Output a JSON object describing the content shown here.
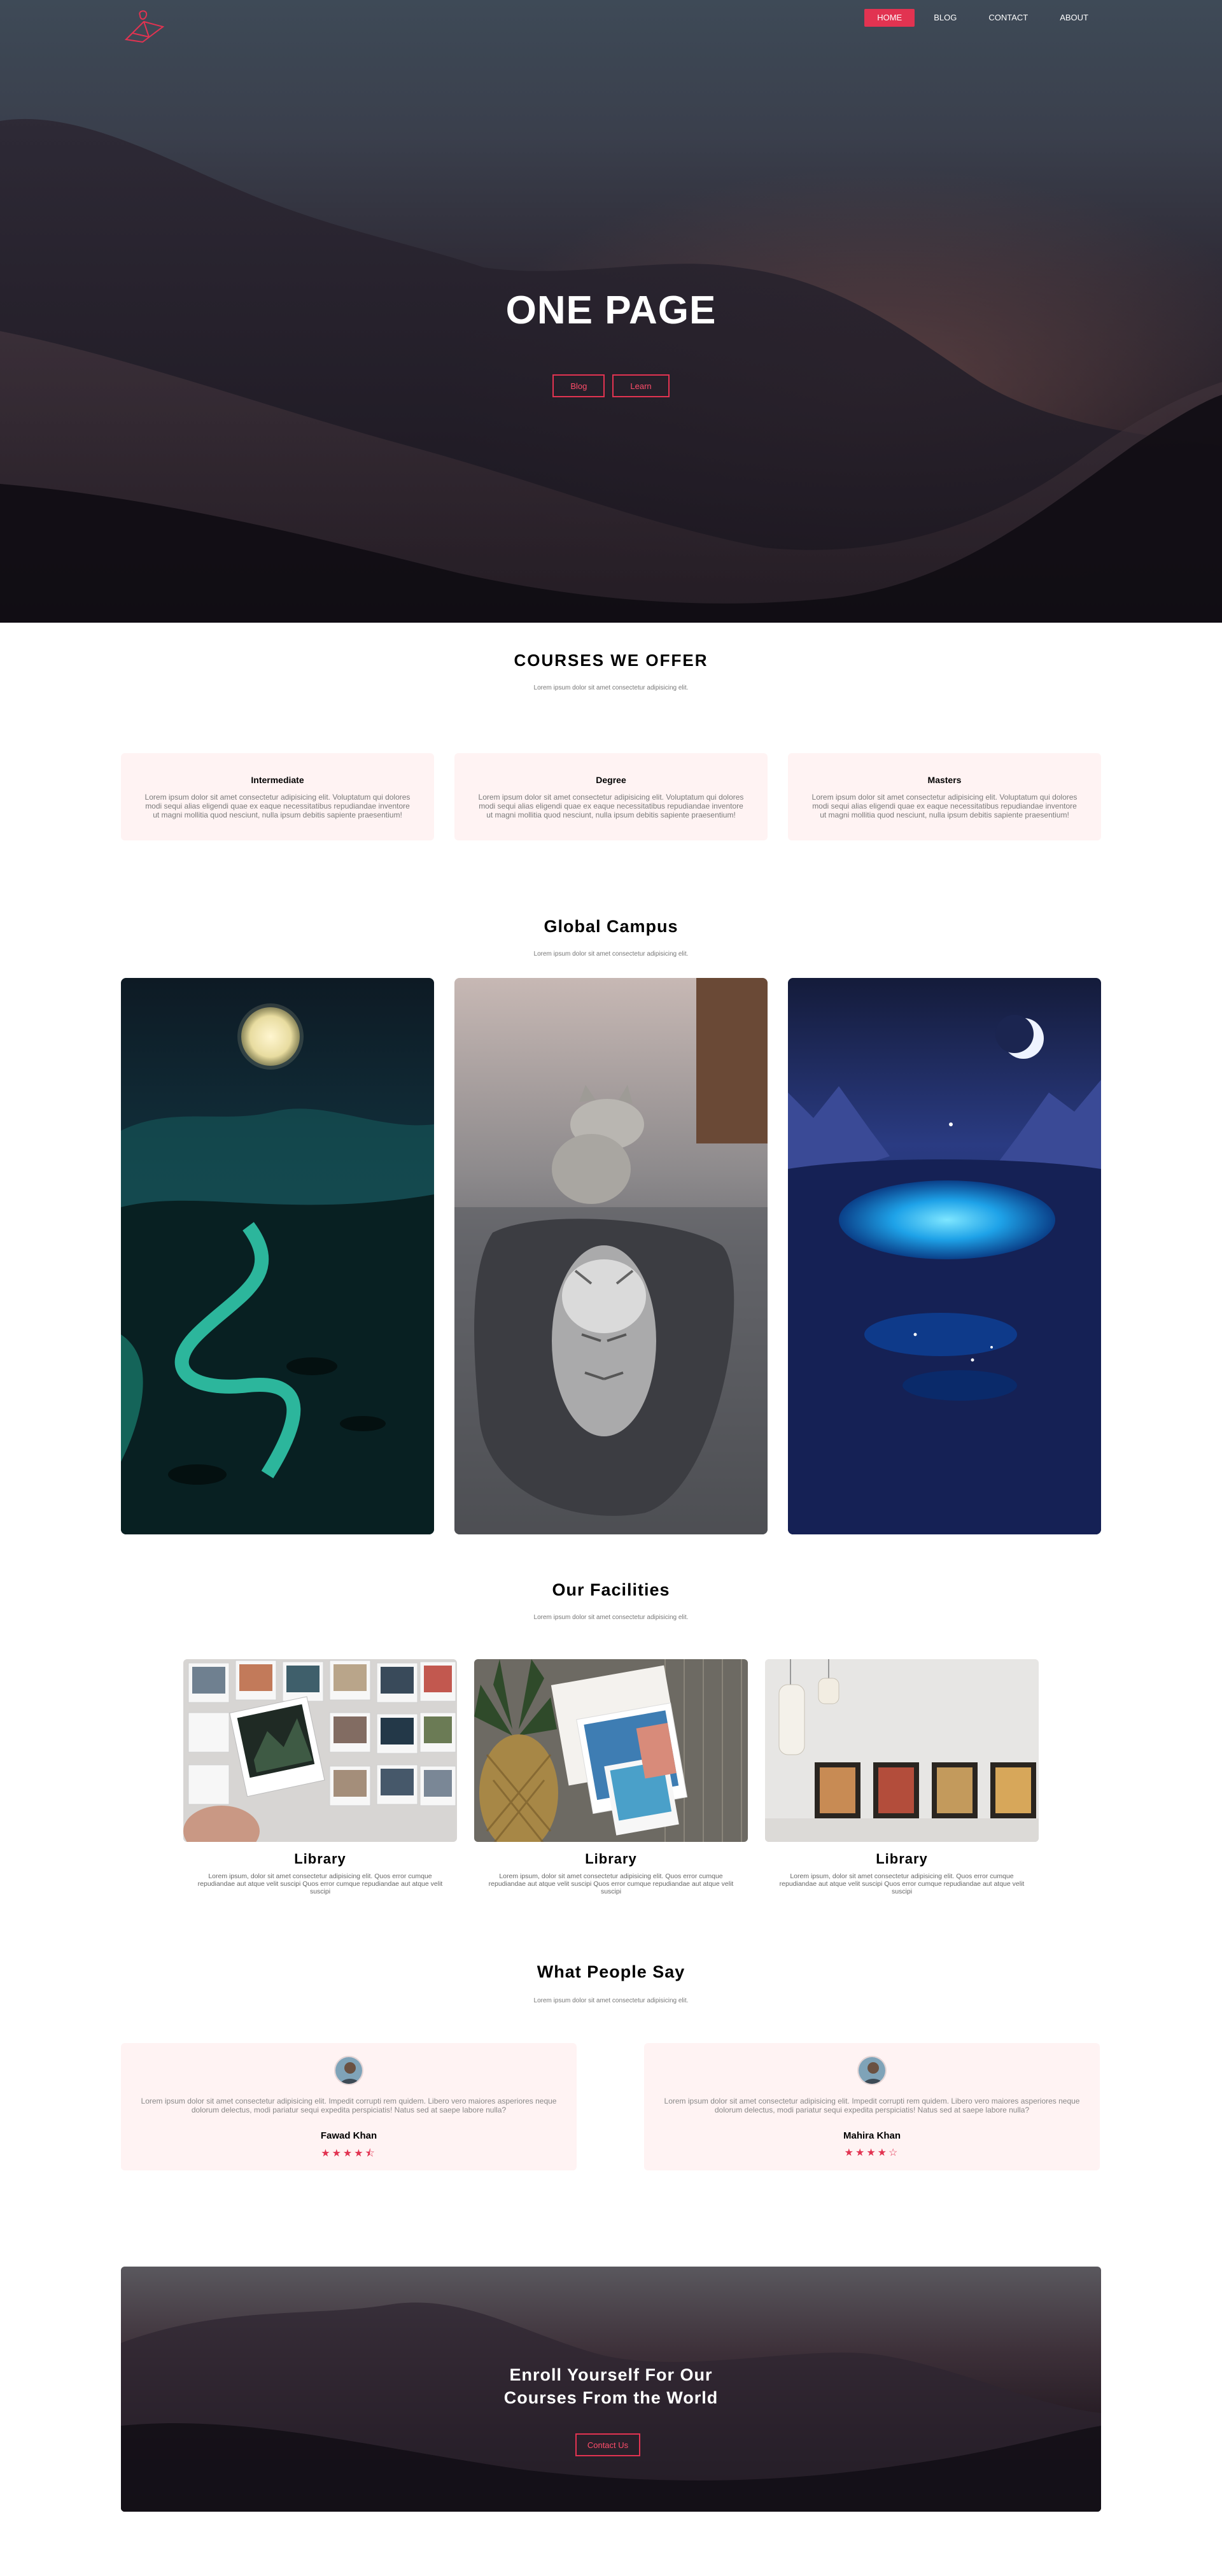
{
  "nav": {
    "logo": "logo-icon",
    "items": [
      {
        "label": "HOME",
        "active": true
      },
      {
        "label": "BLOG",
        "active": false
      },
      {
        "label": "CONTACT",
        "active": false
      },
      {
        "label": "ABOUT",
        "active": false
      }
    ]
  },
  "hero": {
    "title": "ONE PAGE",
    "buttons": [
      "Blog",
      "Learn"
    ]
  },
  "courses": {
    "title": "COURSES WE OFFER",
    "subtitle": "Lorem ipsum dolor sit amet consectetur adipisicing elit.",
    "items": [
      {
        "title": "Intermediate",
        "text": "Lorem ipsum dolor sit amet consectetur adipisicing elit. Voluptatum qui dolores modi sequi alias eligendi quae ex eaque necessitatibus repudiandae inventore ut magni mollitia quod nesciunt, nulla ipsum debitis sapiente praesentium!"
      },
      {
        "title": "Degree",
        "text": "Lorem ipsum dolor sit amet consectetur adipisicing elit. Voluptatum qui dolores modi sequi alias eligendi quae ex eaque necessitatibus repudiandae inventore ut magni mollitia quod nesciunt, nulla ipsum debitis sapiente praesentium!"
      },
      {
        "title": "Masters",
        "text": "Lorem ipsum dolor sit amet consectetur adipisicing elit. Voluptatum qui dolores modi sequi alias eligendi quae ex eaque necessitatibus repudiandae inventore ut magni mollitia quod nesciunt, nulla ipsum debitis sapiente praesentium!"
      }
    ]
  },
  "campus": {
    "title": "Global Campus",
    "subtitle": "Lorem ipsum dolor sit amet consectetur adipisicing elit."
  },
  "facilities": {
    "title": "Our Facilities",
    "subtitle": "Lorem ipsum dolor sit amet consectetur adipisicing elit.",
    "items": [
      {
        "title": "Library",
        "text": "Lorem ipsum, dolor sit amet consectetur adipisicing elit. Quos error cumque repudiandae aut atque velit suscipi Quos error cumque repudiandae aut atque velit suscipi"
      },
      {
        "title": "Library",
        "text": "Lorem ipsum, dolor sit amet consectetur adipisicing elit. Quos error cumque repudiandae aut atque velit suscipi Quos error cumque repudiandae aut atque velit suscipi"
      },
      {
        "title": "Library",
        "text": "Lorem ipsum, dolor sit amet consectetur adipisicing elit. Quos error cumque repudiandae aut atque velit suscipi Quos error cumque repudiandae aut atque velit suscipi"
      }
    ]
  },
  "testimonials": {
    "title": "What People Say",
    "subtitle": "Lorem ipsum dolor sit amet consectetur adipisicing elit.",
    "items": [
      {
        "name": "Fawad Khan",
        "text": "Lorem ipsum dolor sit amet consectetur adipisicing elit. Impedit corrupti rem quidem. Libero vero maiores asperiores neque dolorum delectus, modi pariatur sequi expedita perspiciatis! Natus sed at saepe labore nulla?",
        "stars": "★★★★⯪",
        "rating": 4.5
      },
      {
        "name": "Mahira Khan",
        "text": "Lorem ipsum dolor sit amet consectetur adipisicing elit. Impedit corrupti rem quidem. Libero vero maiores asperiores neque dolorum delectus, modi pariatur sequi expedita perspiciatis! Natus sed at saepe labore nulla?",
        "stars": "★★★★☆",
        "rating": 4
      }
    ]
  },
  "enroll": {
    "title_line1": "Enroll Yourself For Our",
    "title_line2": "Courses From the World",
    "button": "Contact Us"
  },
  "colors": {
    "accent": "#e23351",
    "card_bg": "#fff3f3"
  }
}
